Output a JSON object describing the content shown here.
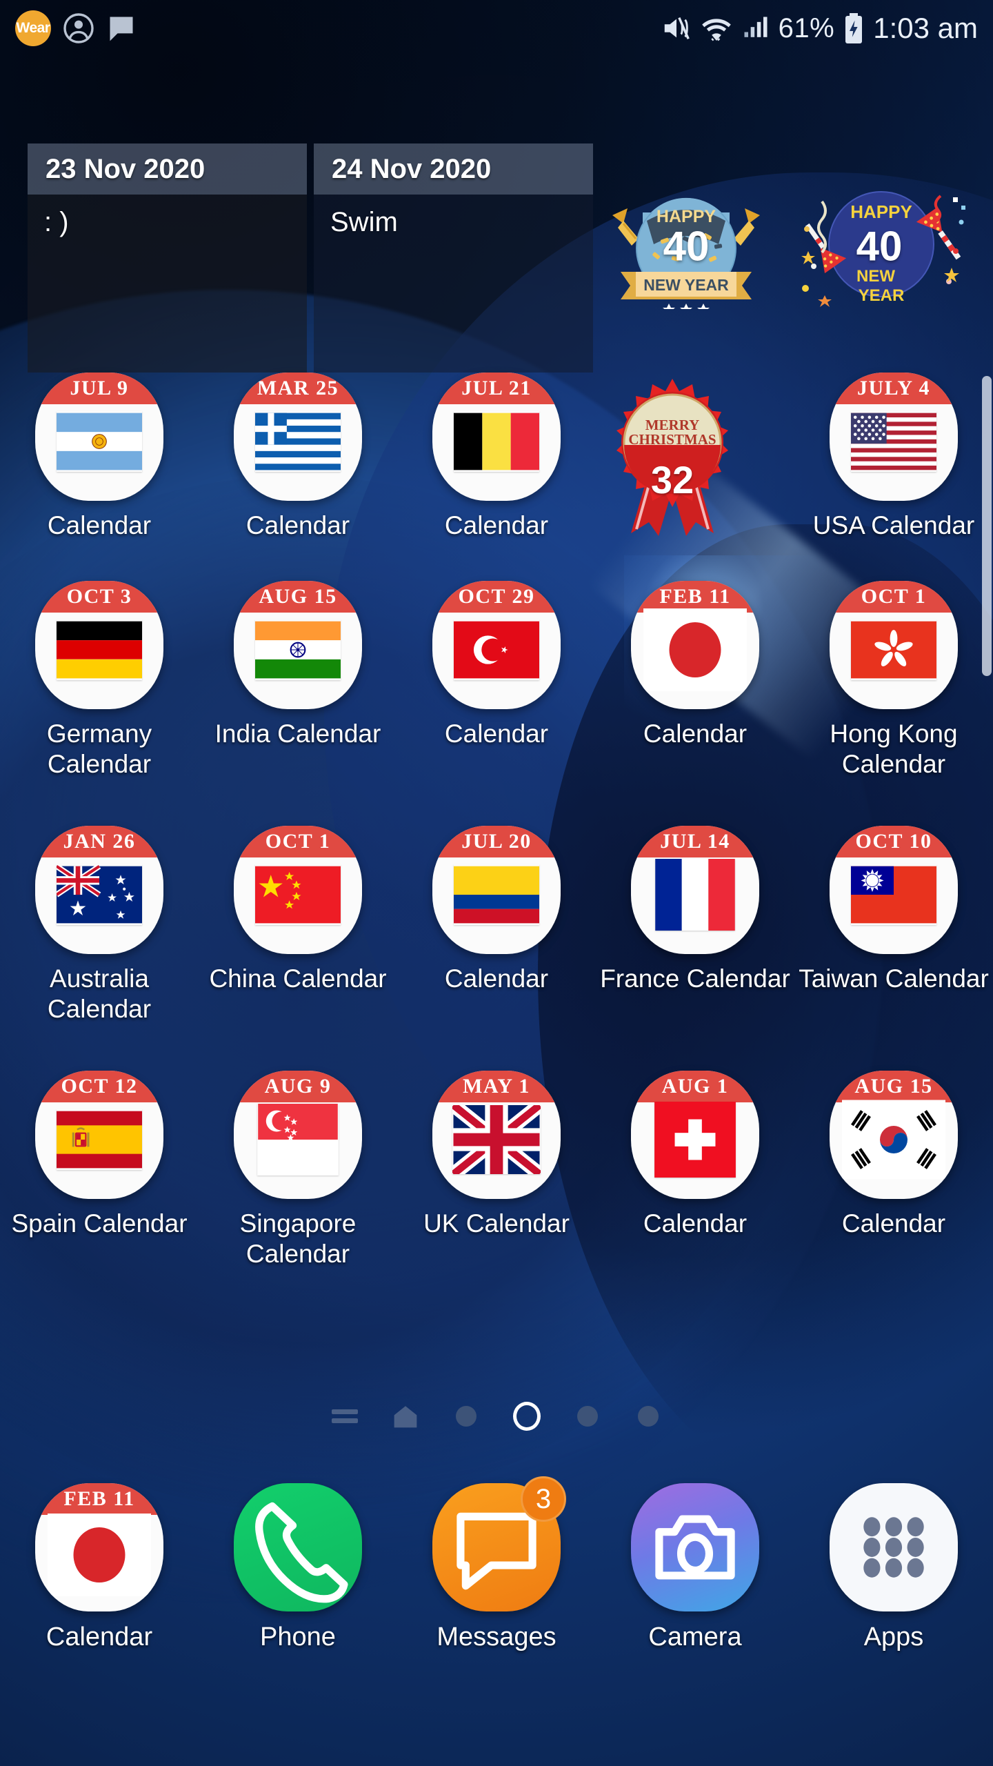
{
  "status_bar": {
    "left_icons": [
      {
        "name": "wear-badge",
        "label": "Wear"
      },
      {
        "name": "account-icon",
        "label": ""
      },
      {
        "name": "message-icon",
        "label": ""
      }
    ],
    "mute_icon": "volume-mute-icon",
    "wifi_icon": "wifi-icon",
    "signal_icon": "cellular-signal-icon",
    "battery_percent": "61%",
    "battery_icon": "battery-charging-icon",
    "clock": "1:03 am"
  },
  "note_widgets": [
    {
      "date": "23 Nov 2020",
      "note": ": )"
    },
    {
      "date": "24 Nov 2020",
      "note": "Swim"
    }
  ],
  "countdown_widgets": [
    {
      "name": "happy-new-year-ribbon-widget",
      "top_text": "HAPPY",
      "count": "40",
      "bottom_text": "NEW YEAR"
    },
    {
      "name": "happy-new-year-confetti-widget",
      "top_text": "HAPPY",
      "count": "40",
      "bottom_text": "NEW YEAR"
    },
    {
      "name": "merry-christmas-rosette-widget",
      "top_text": "MERRY CHRISTMAS",
      "count": "32"
    }
  ],
  "grid": {
    "rows": [
      [
        {
          "date": "JUL 9",
          "label": "Calendar",
          "flag": "argentina"
        },
        {
          "date": "MAR 25",
          "label": "Calendar",
          "flag": "greece"
        },
        {
          "date": "JUL 21",
          "label": "Calendar",
          "flag": "belgium"
        },
        {
          "date": "",
          "label": "",
          "flag": "xmas-badge"
        },
        {
          "date": "JULY 4",
          "label": "USA Calendar",
          "flag": "usa"
        }
      ],
      [
        {
          "date": "OCT 3",
          "label": "Germany Calendar",
          "flag": "germany"
        },
        {
          "date": "AUG 15",
          "label": "India Calendar",
          "flag": "india"
        },
        {
          "date": "OCT 29",
          "label": "Calendar",
          "flag": "turkey"
        },
        {
          "date": "FEB 11",
          "label": "Calendar",
          "flag": "japan"
        },
        {
          "date": "OCT 1",
          "label": "Hong Kong Calendar",
          "flag": "hongkong"
        }
      ],
      [
        {
          "date": "JAN 26",
          "label": "Australia Calendar",
          "flag": "australia"
        },
        {
          "date": "OCT 1",
          "label": "China Calendar",
          "flag": "china"
        },
        {
          "date": "JUL 20",
          "label": "Calendar",
          "flag": "colombia"
        },
        {
          "date": "JUL 14",
          "label": "France Calendar",
          "flag": "france"
        },
        {
          "date": "OCT 10",
          "label": "Taiwan Calendar",
          "flag": "taiwan"
        }
      ],
      [
        {
          "date": "OCT 12",
          "label": "Spain Calendar",
          "flag": "spain"
        },
        {
          "date": "AUG 9",
          "label": "Singapore Calendar",
          "flag": "singapore"
        },
        {
          "date": "MAY 1",
          "label": "UK Calendar",
          "flag": "uk"
        },
        {
          "date": "AUG 1",
          "label": "Calendar",
          "flag": "switzerland"
        },
        {
          "date": "AUG 15",
          "label": "Calendar",
          "flag": "southkorea"
        }
      ]
    ]
  },
  "page_indicator": {
    "items": [
      "lines-icon",
      "home-icon",
      "dot",
      "current-dot",
      "dot",
      "dot"
    ],
    "current_index": 3
  },
  "dock": [
    {
      "label": "Calendar",
      "icon": "calendar-japan-icon",
      "date": "FEB 11",
      "badge": ""
    },
    {
      "label": "Phone",
      "icon": "phone-icon",
      "badge": ""
    },
    {
      "label": "Messages",
      "icon": "messages-icon",
      "badge": "3"
    },
    {
      "label": "Camera",
      "icon": "camera-icon",
      "badge": ""
    },
    {
      "label": "Apps",
      "icon": "apps-grid-icon",
      "badge": ""
    }
  ],
  "colors": {
    "calendar_header_red": "#e04a42",
    "wear_badge_orange": "#f0a830",
    "phone_green": "#13c46a",
    "messages_orange": "#f59019",
    "badge_orange": "#ef7c12"
  }
}
